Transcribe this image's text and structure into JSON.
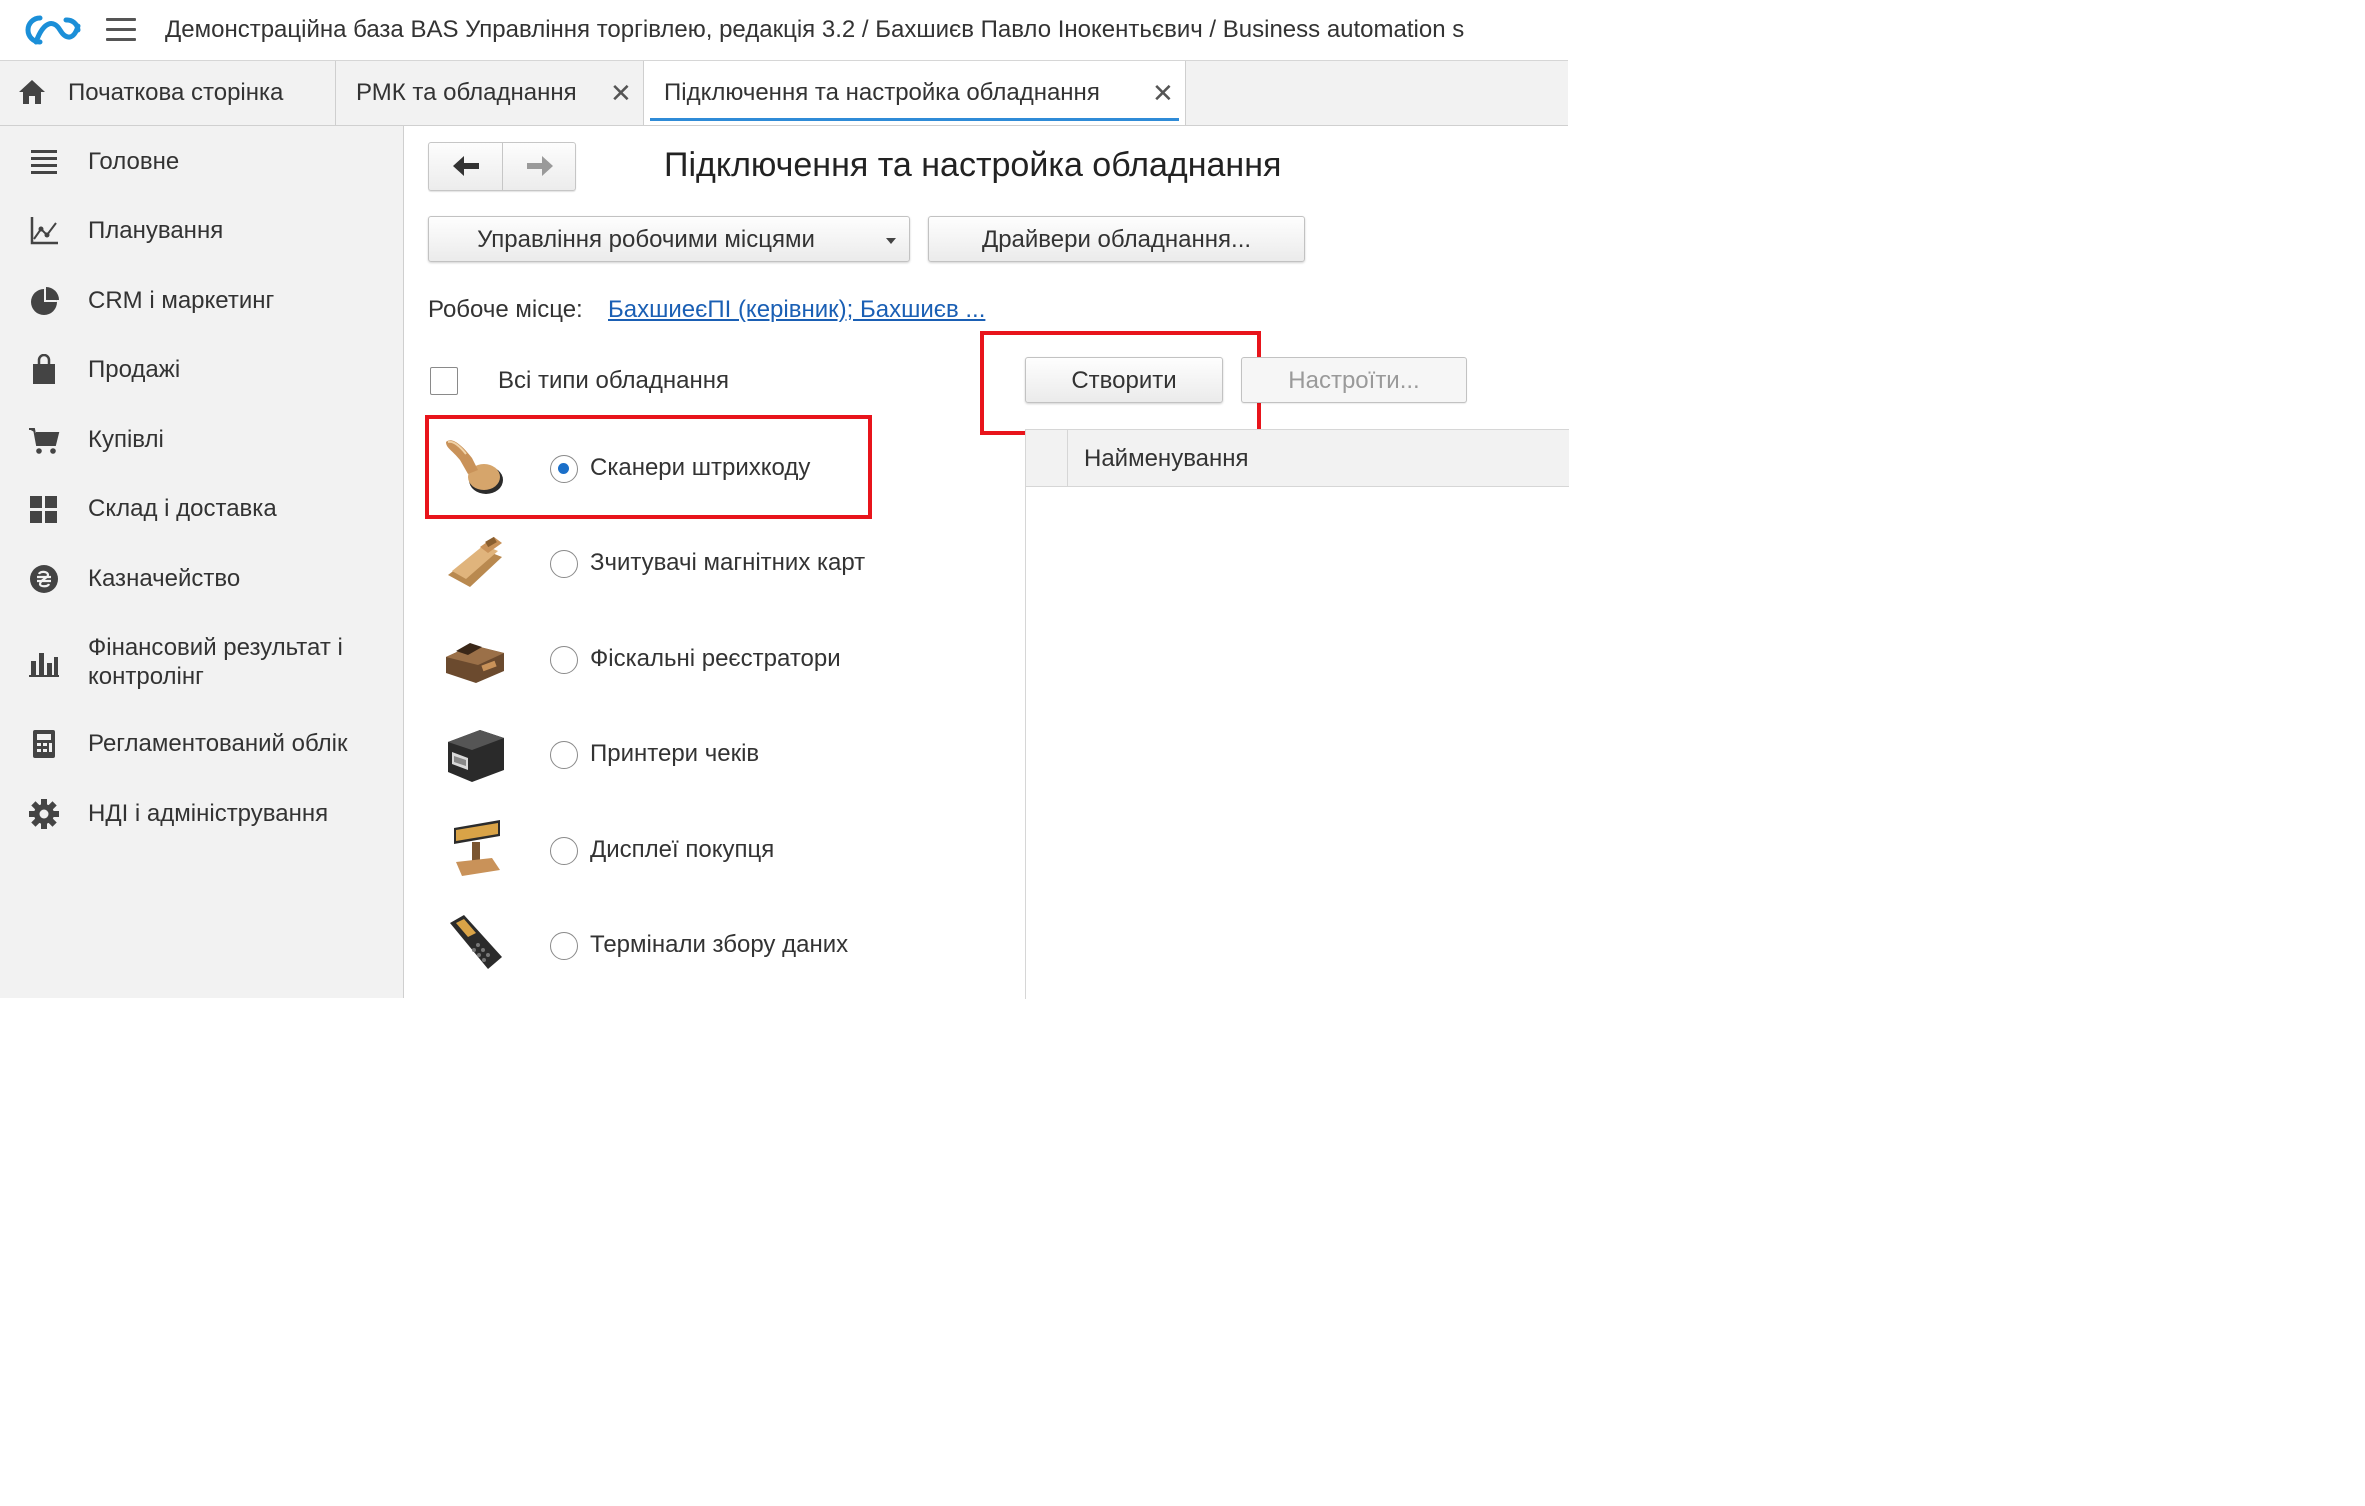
{
  "app": {
    "title": "Демонстраційна база BAS Управління торгівлею, редакція 3.2 / Бахшиєв Павло Інокентьєвич / Business automation s"
  },
  "tabs": [
    {
      "label": "Початкова сторінка",
      "icon": "home-icon"
    },
    {
      "label": "РМК та обладнання",
      "close": "✕"
    },
    {
      "label": "Підключення та настройка обладнання",
      "close": "✕",
      "active": true
    }
  ],
  "sidebar": {
    "items": [
      {
        "label": "Головне",
        "icon": "menu-lines-icon"
      },
      {
        "label": "Планування",
        "icon": "planning-chart-icon"
      },
      {
        "label": "CRM і маркетинг",
        "icon": "pie-chart-icon"
      },
      {
        "label": "Продажі",
        "icon": "shopping-bag-icon"
      },
      {
        "label": "Купівлі",
        "icon": "cart-icon"
      },
      {
        "label": "Склад і доставка",
        "icon": "warehouse-grid-icon"
      },
      {
        "label": "Казначейство",
        "icon": "hryvnia-coin-icon"
      },
      {
        "label": "Фінансовий результат і",
        "label2": "контролінг",
        "icon": "bar-chart-icon"
      },
      {
        "label": "Регламентований облік",
        "icon": "calculator-icon"
      },
      {
        "label": "НДІ і адміністрування",
        "icon": "gear-icon"
      }
    ]
  },
  "main": {
    "title": "Підключення та настройка обладнання",
    "workplaces_button": "Управління робочими місцями",
    "drivers_button": "Драйвери обладнання...",
    "workplace_label": "Робоче місце:",
    "workplace_value": "БахшиеєПІ (керівник); Бахшиєв ...",
    "all_types_label": "Всі типи обладнання",
    "all_types_checked": false,
    "create_button": "Створити",
    "configure_button": "Настроїти...",
    "grid_column": "Найменування",
    "equipment_types": [
      {
        "label": "Сканери штрихкоду",
        "selected": true,
        "icon": "barcode-scanner-icon"
      },
      {
        "label": "Зчитувачі магнітних карт",
        "selected": false,
        "icon": "card-reader-icon"
      },
      {
        "label": "Фіскальні реєстратори",
        "selected": false,
        "icon": "fiscal-register-icon"
      },
      {
        "label": "Принтери чеків",
        "selected": false,
        "icon": "receipt-printer-icon"
      },
      {
        "label": "Дисплеї покупця",
        "selected": false,
        "icon": "customer-display-icon"
      },
      {
        "label": "Термінали збору даних",
        "selected": false,
        "icon": "data-terminal-icon"
      }
    ]
  },
  "colors": {
    "accent": "#2f8bd7",
    "link": "#1a5fb4",
    "highlight": "#e8141b",
    "sidebar_bg": "#f2f2f2"
  }
}
